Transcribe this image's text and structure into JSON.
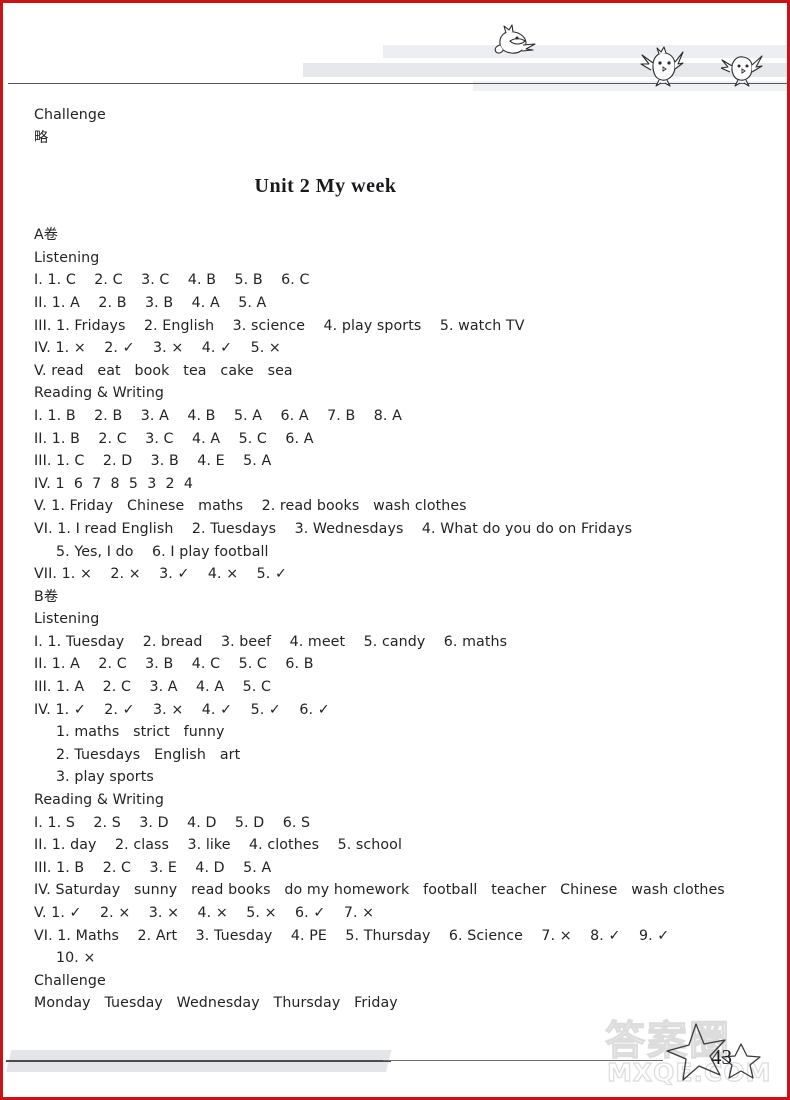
{
  "page": {
    "number": "43",
    "border_color": "#c81414"
  },
  "watermark": {
    "cjk": "答案圈",
    "latin": "MXQE.COM"
  },
  "header": {
    "birds": [
      "bird-flying-icon",
      "bird-perched-icon",
      "bird-perched-icon"
    ]
  },
  "prev_section": {
    "challenge_label": "Challenge",
    "challenge_answer": "略"
  },
  "unit": {
    "title": "Unit  2   My  week"
  },
  "paper_a": {
    "label": "A卷",
    "listening_label": "Listening",
    "listening_lines": [
      "I. 1. C    2. C    3. C    4. B    5. B    6. C",
      "II. 1. A    2. B    3. B    4. A    5. A",
      "III. 1. Fridays    2. English    3. science    4. play sports    5. watch TV",
      "IV. 1. ×    2. ✓    3. ×    4. ✓    5. ×",
      "V. read   eat   book   tea   cake   sea"
    ],
    "reading_label": "Reading & Writing",
    "reading_lines": [
      "I. 1. B    2. B    3. A    4. B    5. A    6. A    7. B    8. A",
      "II. 1. B    2. C    3. C    4. A    5. C    6. A",
      "III. 1. C    2. D    3. B    4. E    5. A",
      "IV. 1  6  7  8  5  3  2  4",
      "V. 1. Friday   Chinese   maths    2. read books   wash clothes",
      "VI. 1. I read English    2. Tuesdays    3. Wednesdays    4. What do you do on Fridays",
      "5. Yes, I do    6. I play football",
      "VII. 1. ×    2. ×    3. ✓    4. ×    5. ✓"
    ]
  },
  "paper_b": {
    "label": "B卷",
    "listening_label": "Listening",
    "listening_lines": [
      "I. 1. Tuesday    2. bread    3. beef    4. meet    5. candy    6. maths",
      "II. 1. A    2. C    3. B    4. C    5. C    6. B",
      "III. 1. A    2. C    3. A    4. A    5. C",
      "IV. 1. ✓    2. ✓    3. ×    4. ✓    5. ✓    6. ✓",
      "1. maths   strict   funny",
      "2. Tuesdays   English   art",
      "3. play sports"
    ],
    "reading_label": "Reading & Writing",
    "reading_lines": [
      "I. 1. S    2. S    3. D    4. D    5. D    6. S",
      "II. 1. day    2. class    3. like    4. clothes    5. school",
      "III. 1. B    2. C    3. E    4. D    5. A",
      "IV. Saturday   sunny   read books   do my homework   football   teacher   Chinese   wash clothes",
      "V. 1. ✓    2. ×    3. ×    4. ×    5. ×    6. ✓    7. ×",
      "VI. 1. Maths    2. Art    3. Tuesday    4. PE    5. Thursday    6. Science    7. ×    8. ✓    9. ✓",
      "10. ×"
    ],
    "challenge_label": "Challenge",
    "challenge_answer": "Monday   Tuesday   Wednesday   Thursday   Friday"
  }
}
